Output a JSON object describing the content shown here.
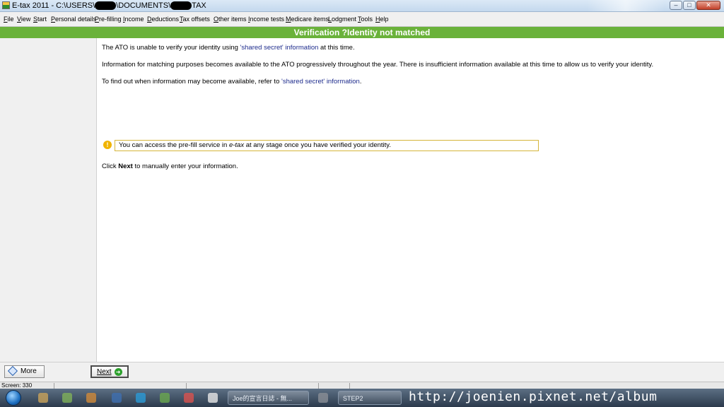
{
  "window": {
    "title_prefix": "E-tax 2011 - C:\\USERS\\",
    "title_mid": "\\DOCUMENTS\\",
    "title_suffix": "TAX",
    "min_label": "–",
    "max_label": "□",
    "close_label": "✕"
  },
  "menu": {
    "items": [
      "File",
      "View",
      "Start",
      "Personal details",
      "Pre-filling",
      "Income",
      "Deductions",
      "Tax offsets",
      "Other items",
      "Income tests",
      "Medicare items",
      "Lodgment",
      "Tools",
      "Help"
    ]
  },
  "header": {
    "title": "Verification ?Identity not matched"
  },
  "content": {
    "p1_pre": "The ATO is unable to verify your identity using ",
    "p1_link": "'shared secret' information",
    "p1_post": " at this time.",
    "p2": "Information for matching purposes becomes available to the ATO progressively throughout the year. There is insufficient information available at this time to allow us to verify your identity.",
    "p3_pre": "To find out when information may become available, refer to ",
    "p3_link": "'shared secret' information",
    "p3_post": ".",
    "notice_pre": "You can access the pre-fill service in ",
    "notice_em": "e-tax",
    "notice_post": " at any stage once you have verified your identity.",
    "click_pre": "Click ",
    "click_bold": "Next",
    "click_post": " to manually enter your information."
  },
  "buttons": {
    "more": "More",
    "next": "Next"
  },
  "status": {
    "screen": "Screen: 330"
  },
  "taskbar": {
    "task1": "Joe的宣言日誌 - 無...",
    "task2": "STEP2"
  },
  "watermark": "http://joenien.pixnet.net/album",
  "colors": {
    "header_green": "#6ab23a",
    "link_blue": "#1d2b8c",
    "notice_border": "#d5b53b"
  }
}
